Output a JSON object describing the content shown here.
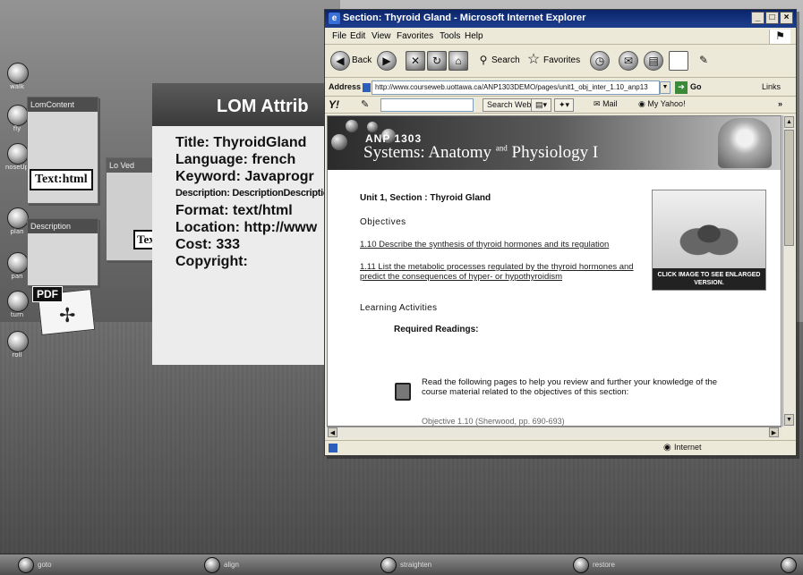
{
  "left_toolbar": {
    "buttons": [
      {
        "label": "walk",
        "icon": "walk-icon"
      },
      {
        "label": "fly",
        "icon": "fly-icon"
      },
      {
        "label": "noseUp",
        "icon": "nose-up-icon"
      },
      {
        "label": "plan",
        "icon": "plan-icon"
      },
      {
        "label": "pan",
        "icon": "pan-icon"
      },
      {
        "label": "turn",
        "icon": "turn-icon"
      },
      {
        "label": "roll",
        "icon": "roll-icon"
      }
    ]
  },
  "scene": {
    "panel1_title": "LomContent",
    "panel1_tag": "Text:html",
    "panel2_title": "Description",
    "panel3_title": "Lo Ved",
    "panel3_tag": "Tex",
    "pdf_label": "PDF"
  },
  "lom": {
    "title": "LOM Attrib",
    "fields": [
      "Title: ThyroidGland",
      "Language: french",
      "Keyword: Javaprogr",
      "Description: DescriptionDescription",
      "Format: text/html",
      "Location: http://www",
      "Cost: 333",
      "Copyright:"
    ]
  },
  "dock": {
    "items": [
      "goto",
      "align",
      "straighten",
      "restore"
    ]
  },
  "browser": {
    "title": "Section: Thyroid Gland - Microsoft Internet Explorer",
    "menu": [
      "File",
      "Edit",
      "View",
      "Favorites",
      "Tools",
      "Help"
    ],
    "toolbar": {
      "back": "Back",
      "search": "Search",
      "favorites": "Favorites"
    },
    "address_label": "Address",
    "address_value": "http://www.courseweb.uottawa.ca/ANP1303DEMO/pages/unit1_obj_inter_1.10_anp13",
    "go_label": "Go",
    "links_label": "Links",
    "yahoo": {
      "logo": "Y!",
      "search_button": "Search Web",
      "mail": "Mail",
      "my_yahoo": "My Yahoo!"
    },
    "status_zone": "Internet",
    "colors": {
      "titlebar": "#0a246a",
      "chrome": "#ece9d8"
    }
  },
  "page": {
    "banner_code": "ANP 1303",
    "banner_course_a": "Systems: Anatomy",
    "banner_course_and": "and",
    "banner_course_b": "Physiology I",
    "section_heading": "Unit 1, Section : Thyroid Gland",
    "objectives_heading": "Objectives",
    "objectives": [
      "1.10 Describe the synthesis of thyroid hormones and its regulation",
      "1.11 List the metabolic processes regulated by the thyroid hormones and predict the consequences of hyper- or hypothyroidism"
    ],
    "learning_heading": "Learning Activities",
    "readings_heading": "Required Readings:",
    "readings_text": "Read the following pages to help you review and further your knowledge of the course material related to the objectives of this section:",
    "cut_line": "Objective 1.10 (Sherwood, pp. 690-693)",
    "thumb_caption": "CLICK IMAGE TO SEE ENLARGED VERSION."
  }
}
